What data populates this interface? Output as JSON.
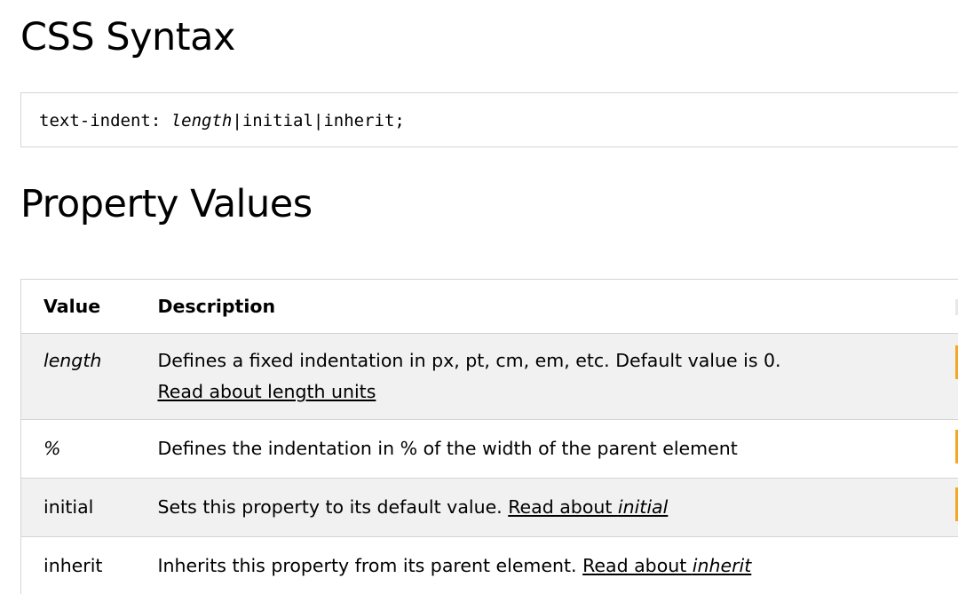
{
  "syntax": {
    "heading": "CSS Syntax",
    "code": {
      "property": "text-indent: ",
      "value_italic": "length",
      "sep1": "|",
      "initial": "initial",
      "sep2": "|",
      "inherit": "inherit",
      "end": ";"
    }
  },
  "property_values": {
    "heading": "Property Values",
    "columns": {
      "value": "Value",
      "description": "Description"
    },
    "rows": [
      {
        "value": "length",
        "description": "Defines a fixed indentation in px, pt, cm, em, etc. Default value is 0.",
        "link": "Read about length units"
      },
      {
        "value": "%",
        "description": "Defines the indentation in % of the width of the parent element"
      },
      {
        "value": "initial",
        "description": "Sets this property to its default value. ",
        "link_prefix": "Read about ",
        "link_italic": "initial"
      },
      {
        "value": "inherit",
        "description": "Inherits this property from its parent element. ",
        "link_prefix": "Read about ",
        "link_italic": "inherit"
      }
    ]
  },
  "colors": {
    "row_shade": "#f1f1f1",
    "border": "#d4d4d4",
    "edge_accent": "#f5a623"
  }
}
